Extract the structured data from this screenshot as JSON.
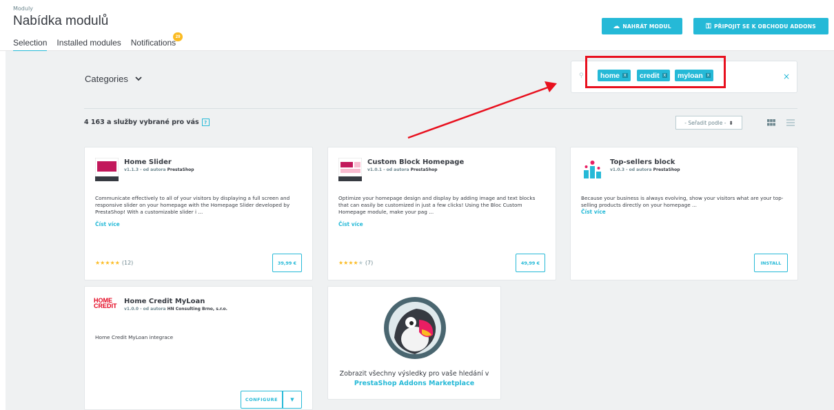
{
  "header": {
    "breadcrumb": "Moduly",
    "title": "Nabídka modulů",
    "tabs": [
      {
        "label": "Selection",
        "active": true
      },
      {
        "label": "Installed modules",
        "active": false
      },
      {
        "label": "Notifications",
        "badge": "29"
      }
    ],
    "upload_button": "NAHRÁT MODUL",
    "connect_button": "PŘIPOJIT SE K OBCHODU ADDONS"
  },
  "filters": {
    "categories_label": "Categories",
    "tags": [
      "home",
      "credit",
      "myloan"
    ],
    "tag_remove": "x",
    "clear": "×"
  },
  "results": {
    "count_text": "4 163 a služby vybrané pro vás",
    "help": "?",
    "sort_label": "- Seřadit podle -",
    "sort_arrow": "⬍"
  },
  "modules": [
    {
      "title": "Home Slider",
      "version": "v1.1.3 - od autora",
      "author": "PrestaShop",
      "description": "Communicate effectively to all of your visitors by displaying a full screen and responsive slider on your homepage with the Homepage Slider developed by PrestaShop!  With a customizable slider i ...",
      "more": "Číst více",
      "stars": "★★★★★",
      "rating_count": "(12)",
      "action": "39,99 €"
    },
    {
      "title": "Custom Block Homepage",
      "version": "v1.0.1 - od autora",
      "author": "PrestaShop",
      "description": "Optimize your homepage design and display by adding image and text blocks that can easily be customized in just a few clicks!  Using the Bloc Custom Homepage module, make your pag ...",
      "more": "Číst více",
      "stars": "★★★★",
      "stars_empty": "★",
      "rating_count": "(7)",
      "action": "49,99 €"
    },
    {
      "title": "Top-sellers block",
      "version": "v1.0.3 - od autora",
      "author": "PrestaShop",
      "description": "Because your business is always evolving, show your visitors what are your top-selling products directly on your homepage ...",
      "more": "Číst více",
      "action": "INSTALL"
    },
    {
      "title": "Home Credit MyLoan",
      "version": "v1.0.0 - od autora",
      "author": "HN Consulting Brno, s.r.o.",
      "description": "Home Credit MyLoan integrace",
      "logo_text_1": "HOME",
      "logo_text_2": "CREDIT",
      "action": "CONFIGURE",
      "dropdown": "▼"
    }
  ],
  "promo": {
    "text": "Zobrazit všechny výsledky pro vaše hledání v",
    "link": "PrestaShop Addons Marketplace"
  },
  "colors": {
    "accent": "#25b9d7",
    "annotation": "#e8101e",
    "star": "#fbbb22"
  }
}
